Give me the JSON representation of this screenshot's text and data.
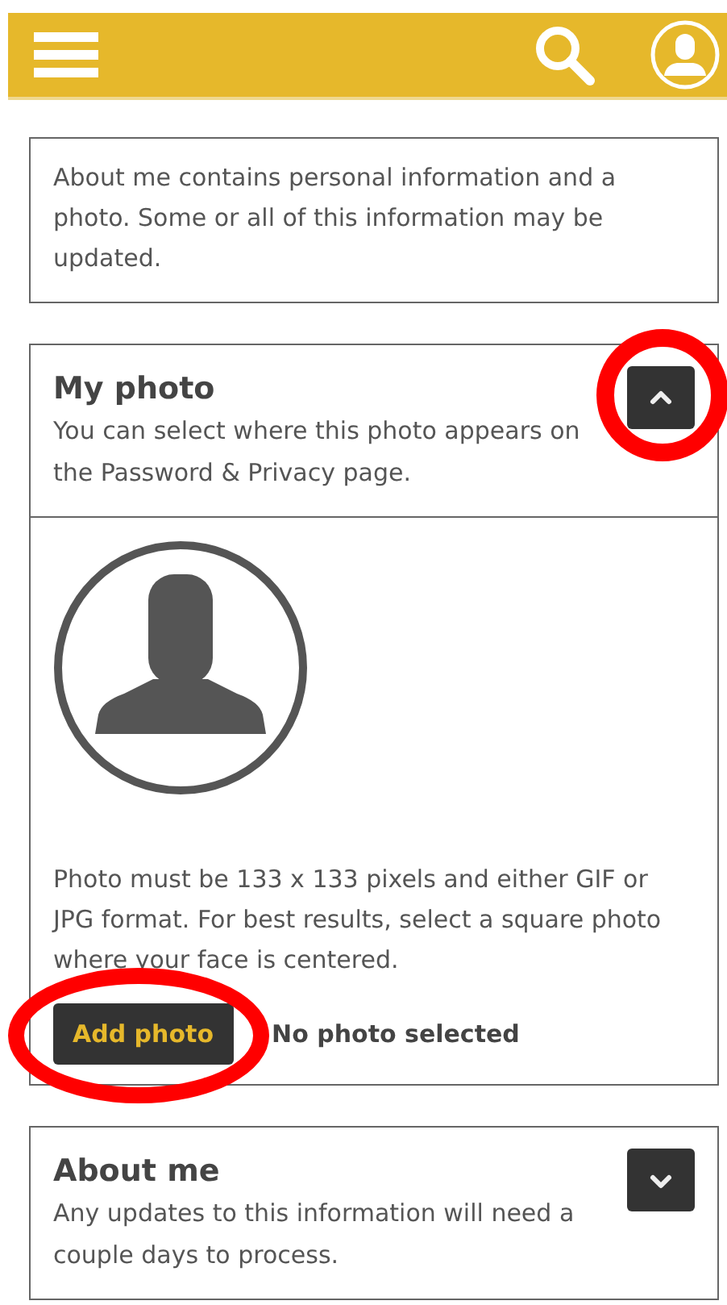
{
  "intro": "About me contains personal information and a photo. Some or all of this information may be updated.",
  "sections": [
    {
      "title": "My photo",
      "description": "You can select where this photo appears on the Password & Privacy page.",
      "expanded": true,
      "toggle_circled": true,
      "body": {
        "hint": "Photo must be 133 x 133 pixels and either GIF or JPG format. For best results, select a square photo where your face is centered.",
        "button": "Add photo",
        "button_circled": true,
        "status": "No photo selected"
      }
    },
    {
      "title": "About me",
      "description": "Any updates to this information will need a couple days to process.",
      "expanded": false,
      "toggle_circled": false
    }
  ]
}
